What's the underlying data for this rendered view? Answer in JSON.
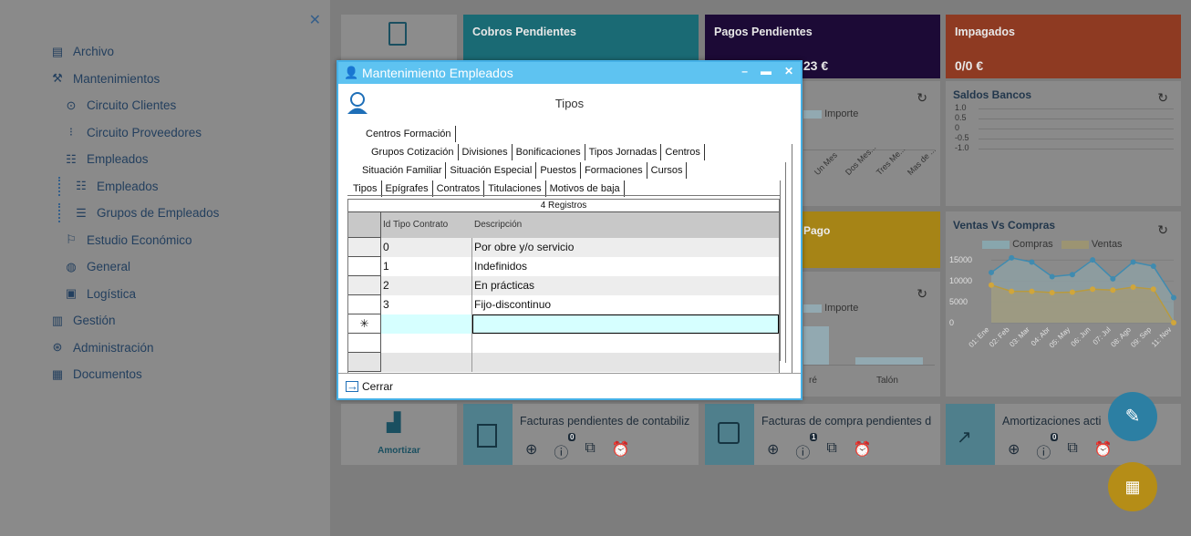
{
  "sidebar": {
    "items": [
      {
        "icon": "file-icon",
        "glyph": "▤",
        "label": "Archivo",
        "level": 0
      },
      {
        "icon": "tools-icon",
        "glyph": "⚒",
        "label": "Mantenimientos",
        "level": 0
      },
      {
        "icon": "client-circle-icon",
        "glyph": "⊙",
        "label": "Circuito Clientes",
        "level": 1
      },
      {
        "icon": "supplier-icon",
        "glyph": "⁝",
        "label": "Circuito Proveedores",
        "level": 1
      },
      {
        "icon": "people-icon",
        "glyph": "☷",
        "label": "Empleados",
        "level": 1
      },
      {
        "icon": "people-icon",
        "glyph": "☷",
        "label": "Empleados",
        "level": 2
      },
      {
        "icon": "group-icon",
        "glyph": "☰",
        "label": "Grupos de Empleados",
        "level": 2
      },
      {
        "icon": "economy-icon",
        "glyph": "⚐",
        "label": "Estudio Económico",
        "level": 1
      },
      {
        "icon": "globe-icon",
        "glyph": "◍",
        "label": "General",
        "level": 1
      },
      {
        "icon": "logistics-icon",
        "glyph": "▣",
        "label": "Logística",
        "level": 1
      },
      {
        "icon": "management-icon",
        "glyph": "▥",
        "label": "Gestión",
        "level": 0
      },
      {
        "icon": "admin-icon",
        "glyph": "⊛",
        "label": "Administración",
        "level": 0
      },
      {
        "icon": "documents-icon",
        "glyph": "▦",
        "label": "Documentos",
        "level": 0
      }
    ]
  },
  "kpis": {
    "cobros": {
      "title": "Cobros Pendientes"
    },
    "pagos": {
      "title": "Pagos Pendientes",
      "value": ".23 €"
    },
    "impagados": {
      "title": "Impagados",
      "value": "0/0 €"
    }
  },
  "panels": {
    "importe_top": {
      "legend": "Importe",
      "ticks": [
        "Un Mes",
        "Dos Mes...",
        "Tres Me...",
        "Mas de ..."
      ]
    },
    "saldos": {
      "title": "Saldos Bancos",
      "yticks": [
        "1.0",
        "0.5",
        "0",
        "-0.5",
        "-1.0"
      ]
    },
    "pago": {
      "title": "Pago"
    },
    "importe_bottom": {
      "legend": "Importe",
      "ticks": [
        "ré",
        "Talón"
      ]
    },
    "ventas": {
      "title": "Ventas Vs Compras",
      "legend": [
        "Compras",
        "Ventas"
      ],
      "yticks": [
        "15000",
        "10000",
        "5000",
        "0"
      ]
    }
  },
  "chart_data": {
    "type": "area",
    "title": "Ventas Vs Compras",
    "categories": [
      "01: Ene",
      "02: Feb",
      "03: Mar",
      "04: Abr",
      "05: May",
      "06: Jun",
      "07: Jul",
      "08: Ago",
      "09: Sep",
      "11: Nov"
    ],
    "series": [
      {
        "name": "Compras",
        "values": [
          12000,
          15500,
          14500,
          11000,
          11500,
          15000,
          10500,
          14500,
          13500,
          6000
        ]
      },
      {
        "name": "Ventas",
        "values": [
          9000,
          7500,
          7500,
          7200,
          7300,
          8000,
          7800,
          8500,
          8000,
          0
        ]
      }
    ],
    "ylim": [
      0,
      17000
    ]
  },
  "bottom": {
    "amortizar": "Amortizar",
    "fact_pend": "Facturas pendientes de contabiliz",
    "fact_compra": "Facturas de compra pendientes d",
    "amort_act": "Amortizaciones acti",
    "badge0": "0",
    "badge1": "1"
  },
  "modal": {
    "title": "Mantenimiento Empleados",
    "heading": "Tipos",
    "tabs_row1": [
      "Centros Formación"
    ],
    "tabs_row2": [
      "Grupos Cotización",
      "Divisiones",
      "Bonificaciones",
      "Tipos Jornadas",
      "Centros"
    ],
    "tabs_row3": [
      "Situación Familiar",
      "Situación Especial",
      "Puestos",
      "Formaciones",
      "Cursos"
    ],
    "tabs_row4": [
      "Tipos",
      "Epígrafes",
      "Contratos",
      "Titulaciones",
      "Motivos de baja"
    ],
    "records": "4 Registros",
    "col_id": "Id Tipo Contrato",
    "col_desc": "Descripción",
    "rows": [
      {
        "id": "0",
        "desc": "Por obre y/o servicio"
      },
      {
        "id": "1",
        "desc": "Indefinidos"
      },
      {
        "id": "2",
        "desc": "En prácticas"
      },
      {
        "id": "3",
        "desc": "Fijo-discontinuo"
      }
    ],
    "new_marker": "✳",
    "close": "Cerrar"
  }
}
